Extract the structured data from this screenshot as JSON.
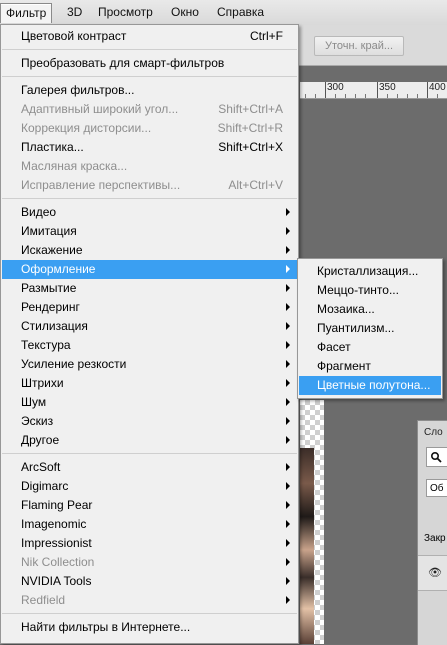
{
  "menubar": {
    "items": [
      {
        "label": "Фильтр",
        "active": true
      },
      {
        "label": "3D"
      },
      {
        "label": "Просмотр"
      },
      {
        "label": "Окно"
      },
      {
        "label": "Справка"
      }
    ]
  },
  "options_bar": {
    "refine_edge_label": "Уточн. край..."
  },
  "ruler": {
    "labels": [
      "300",
      "350",
      "400"
    ]
  },
  "layers_panel": {
    "tab_label": "Сло",
    "search_icon": "search-icon",
    "kind_label": "Об",
    "lock_label": "Закр",
    "eye_icon": "eye-icon"
  },
  "filter_menu": {
    "items": [
      {
        "label": "Цветовой контраст",
        "shortcut": "Ctrl+F"
      },
      {
        "type": "separator"
      },
      {
        "label": "Преобразовать для смарт-фильтров"
      },
      {
        "type": "separator"
      },
      {
        "label": "Галерея фильтров..."
      },
      {
        "label": "Адаптивный широкий угол...",
        "shortcut": "Shift+Ctrl+A",
        "disabled": true
      },
      {
        "label": "Коррекция дисторсии...",
        "shortcut": "Shift+Ctrl+R",
        "disabled": true
      },
      {
        "label": "Пластика...",
        "shortcut": "Shift+Ctrl+X"
      },
      {
        "label": "Масляная краска...",
        "disabled": true
      },
      {
        "label": "Исправление перспективы...",
        "shortcut": "Alt+Ctrl+V",
        "disabled": true
      },
      {
        "type": "separator"
      },
      {
        "label": "Видео",
        "submenu": true
      },
      {
        "label": "Имитация",
        "submenu": true
      },
      {
        "label": "Искажение",
        "submenu": true
      },
      {
        "label": "Оформление",
        "submenu": true,
        "highlight": true
      },
      {
        "label": "Размытие",
        "submenu": true
      },
      {
        "label": "Рендеринг",
        "submenu": true
      },
      {
        "label": "Стилизация",
        "submenu": true
      },
      {
        "label": "Текстура",
        "submenu": true
      },
      {
        "label": "Усиление резкости",
        "submenu": true
      },
      {
        "label": "Штрихи",
        "submenu": true
      },
      {
        "label": "Шум",
        "submenu": true
      },
      {
        "label": "Эскиз",
        "submenu": true
      },
      {
        "label": "Другое",
        "submenu": true
      },
      {
        "type": "separator"
      },
      {
        "label": "ArcSoft",
        "submenu": true
      },
      {
        "label": "Digimarc",
        "submenu": true
      },
      {
        "label": "Flaming Pear",
        "submenu": true
      },
      {
        "label": "Imagenomic",
        "submenu": true
      },
      {
        "label": "Impressionist",
        "submenu": true
      },
      {
        "label": "Nik Collection",
        "submenu": true,
        "disabled": true
      },
      {
        "label": "NVIDIA Tools",
        "submenu": true
      },
      {
        "label": "Redfield",
        "submenu": true,
        "disabled": true
      },
      {
        "type": "separator"
      },
      {
        "label": "Найти фильтры в Интернете..."
      }
    ]
  },
  "submenu": {
    "items": [
      {
        "label": "Кристаллизация..."
      },
      {
        "label": "Меццо-тинто..."
      },
      {
        "label": "Мозаика..."
      },
      {
        "label": "Пуантилизм..."
      },
      {
        "label": "Фасет"
      },
      {
        "label": "Фрагмент"
      },
      {
        "label": "Цветные полутона...",
        "highlight": true
      }
    ]
  }
}
